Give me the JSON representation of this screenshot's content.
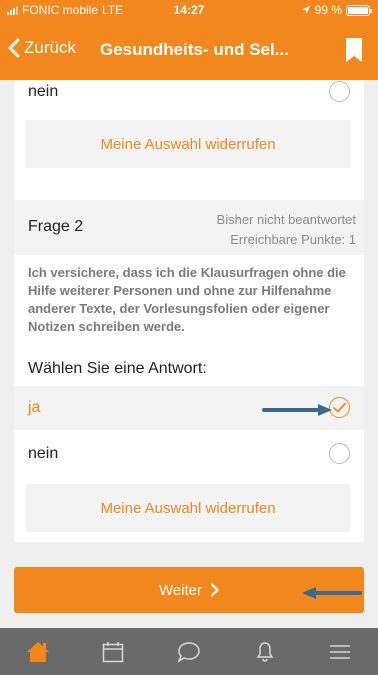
{
  "status_bar": {
    "carrier": "FONIC mobile",
    "network": "LTE",
    "time": "14:27",
    "battery": "99 %"
  },
  "navbar": {
    "back_label": "Zurück",
    "title": "Gesundheits- und Sel..."
  },
  "question1": {
    "option_nein": "nein",
    "withdraw_label": "Meine Auswahl widerrufen"
  },
  "question2": {
    "title": "Frage 2",
    "status": "Bisher nicht beantwortet",
    "points": "Erreichbare Punkte: 1",
    "text": "Ich versichere, dass ich die Klausurfragen ohne die Hilfe weiterer Personen und ohne zur Hilfenahme anderer Texte, der Vorlesungsfolien oder eigener Notizen schreiben werde.",
    "prompt": "Wählen Sie eine Antwort:",
    "options": [
      "ja",
      "nein"
    ],
    "selected": "ja",
    "withdraw_label": "Meine Auswahl widerrufen"
  },
  "next_button": {
    "label": "Weiter"
  },
  "tabbar": {
    "icons": [
      "home-icon",
      "calendar-icon",
      "chat-icon",
      "bell-icon",
      "menu-icon"
    ]
  },
  "colors": {
    "accent": "#f2871d",
    "tabbar": "#6a6a6a",
    "annotation_arrow": "#3d6a8a"
  }
}
